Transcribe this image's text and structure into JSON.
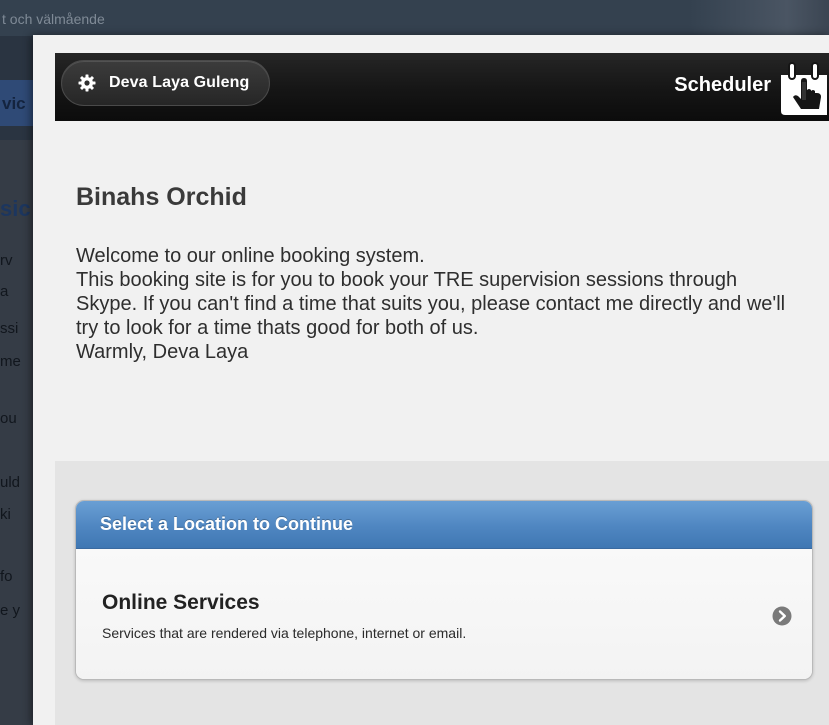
{
  "background": {
    "topbar_text": "t och välmående",
    "nav_fragment": "vic",
    "heading_fragment": "sic",
    "fragments": [
      "rv",
      "a",
      "ssi",
      "me",
      "ou",
      "uld",
      "ki",
      "fo",
      "e y"
    ]
  },
  "header": {
    "user_name": "Deva Laya Guleng",
    "app_title": "Scheduler",
    "user_icon": "gear-icon",
    "logo_icon": "calendar-hand-icon"
  },
  "content": {
    "business_name": "Binahs Orchid",
    "welcome_text": "Welcome to our online booking system.\nThis booking site is for you to book your TRE supervision sessions through Skype. If you can't find a time that suits you, please contact me directly and we'll try to look for a time thats good for both of us.\nWarmly, Deva Laya"
  },
  "location_panel": {
    "header": "Select a Location to Continue",
    "locations": [
      {
        "name": "Online Services",
        "description": "Services that are rendered via telephone, internet or email.",
        "icon": "chevron-right-icon"
      }
    ]
  },
  "colors": {
    "header_bg": "#151515",
    "panel_header": "#4f86c1",
    "modal_bg": "#f1f1f1"
  }
}
